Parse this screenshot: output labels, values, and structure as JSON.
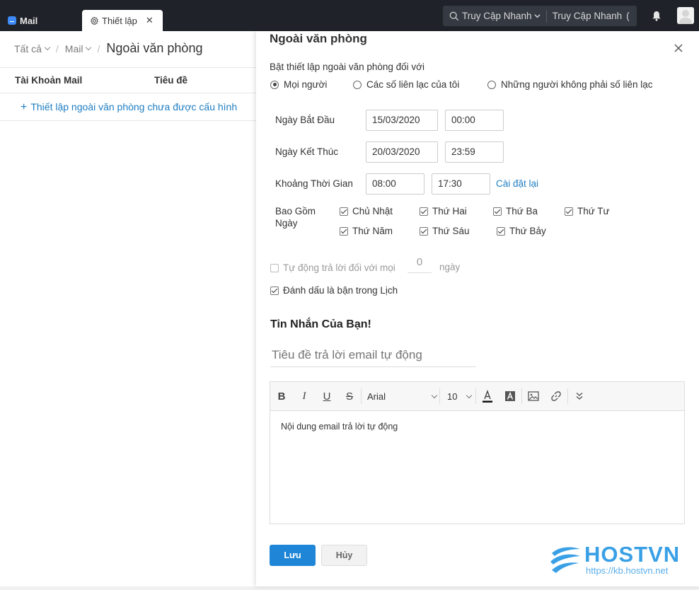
{
  "topbar": {
    "mail_tab": "Mail",
    "settings_tab": "Thiết lập",
    "quick_access_1": "Truy Cập Nhanh",
    "quick_access_2": "Truy Cập Nhanh"
  },
  "breadcrumb": {
    "all": "Tất cả",
    "mail": "Mail",
    "current": "Ngoài văn phòng"
  },
  "list": {
    "col_account": "Tài Khoản Mail",
    "col_subject": "Tiêu đề",
    "add_label": "Thiết lập ngoài văn phòng chưa được cấu hình"
  },
  "panel": {
    "title": "Ngoài văn phòng",
    "enable_label": "Bật thiết lập ngoài văn phòng đối với",
    "radios": [
      {
        "label": "Mọi người",
        "checked": true
      },
      {
        "label": "Các số liên lạc của tôi",
        "checked": false
      },
      {
        "label": "Những người không phải số liên lạc",
        "checked": false
      }
    ],
    "start_label": "Ngày Bắt Đầu",
    "start_date": "15/03/2020",
    "start_time": "00:00",
    "end_label": "Ngày Kết Thúc",
    "end_date": "20/03/2020",
    "end_time": "23:59",
    "period_label": "Khoảng Thời Gian",
    "period_from": "08:00",
    "period_to": "17:30",
    "reset": "Cài đặt lại",
    "days_label": "Bao Gồm Ngày",
    "days": [
      {
        "label": "Chủ Nhật",
        "checked": true
      },
      {
        "label": "Thứ Hai",
        "checked": true
      },
      {
        "label": "Thứ Ba",
        "checked": true
      },
      {
        "label": "Thứ Tư",
        "checked": true
      },
      {
        "label": "Thứ Năm",
        "checked": true
      },
      {
        "label": "Thứ Sáu",
        "checked": true
      },
      {
        "label": "Thứ Bảy",
        "checked": true
      }
    ],
    "auto_reply_label": "Tự động trả lời đối với mọi",
    "auto_reply_value": "0",
    "auto_reply_unit": "ngày",
    "busy_label": "Đánh dấu là bận trong Lịch",
    "message_title": "Tin Nhắn Của Bạn!",
    "subject_placeholder": "Tiêu đề trả lời email tự động",
    "font": "Arial",
    "font_size": "10",
    "body_placeholder": "Nội dung email trả lời tự động",
    "save": "Lưu",
    "cancel": "Hủy"
  },
  "watermark": {
    "brand": "HOSTVN",
    "url": "https://kb.hostvn.net"
  },
  "colors": {
    "topbar": "#1f2329",
    "accent": "#1f86d7",
    "link": "#1f7ec2"
  }
}
